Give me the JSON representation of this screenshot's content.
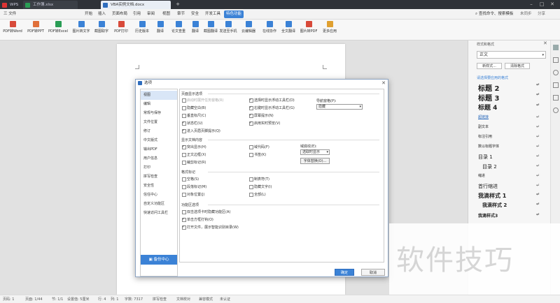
{
  "tabs": {
    "wps": "WPS",
    "xlsx": "工作簿.xlsx",
    "docx": "VBA实例文档.docx",
    "new_tab": "+"
  },
  "menu": {
    "file": "三 文件",
    "items": [
      "开始",
      "插入",
      "页面布局",
      "引用",
      "审阅",
      "视图",
      "章节",
      "安全",
      "开发工具",
      "特色功能"
    ],
    "search": "查找命令、搜索模板",
    "sync": "未同步",
    "share": "分享"
  },
  "ribbon": [
    "PDF转Word",
    "PDF转PPT",
    "PDF转Excel",
    "图片转文字",
    "截图取字",
    "PDF打印",
    "历史版本",
    "翻译",
    "论文查重",
    "翻译",
    "截图翻译",
    "发送至手机",
    "云编辑器",
    "在线协作",
    "全文翻译",
    "图片转PDF",
    "更多应用"
  ],
  "sidepanel": {
    "title": "样式和格式",
    "current_style": "正文",
    "new_style": "新样式...",
    "clear_format": "清除格式",
    "section_label": "请选择要应用的格式",
    "styles": [
      "标题 2",
      "标题 3",
      "标题 4",
      "超链接",
      "副文本",
      "标注引用",
      "数以标题字体",
      "目录 1",
      "目录 2",
      "缩进",
      "首行缩进",
      "我滴样式 1",
      "我滴样式 2",
      "我滴样式3"
    ]
  },
  "dialog": {
    "title": "选项",
    "nav": [
      "视图",
      "编辑",
      "常规与保存",
      "文件位置",
      "修订",
      "中文版式",
      "输出PDF",
      "用户信息",
      "打印",
      "拼写检查",
      "安全性",
      "信任中心",
      "自定义功能区",
      "快速访问工具栏"
    ],
    "backup": "备份中心",
    "sections": {
      "page_display": "页面显示选项",
      "show_content": "显示文档内容",
      "format_marks": "格式标记",
      "func_options": "功能区选项"
    },
    "checkboxes": {
      "page_display": [
        {
          "label": "启动时展开任务窗格(R)",
          "checked": false,
          "disabled": true
        },
        {
          "label": "隐藏空白(B)",
          "checked": false
        },
        {
          "label": "垂直标尺(C)",
          "checked": false
        },
        {
          "label": "状态栏(U)",
          "checked": true
        },
        {
          "label": "进入页眉页脚提示(Q)",
          "checked": true
        },
        {
          "label": "选择时显示浮动工具栏(D)",
          "checked": true
        },
        {
          "label": "右键时显示浮动工具栏(G)",
          "checked": true
        },
        {
          "label": "屏幕提示(N)",
          "checked": true
        },
        {
          "label": "启用实时预览(V)",
          "checked": true
        }
      ],
      "show_content": [
        {
          "label": "突出显示(H)",
          "checked": true
        },
        {
          "label": "正文边框(X)",
          "checked": false
        },
        {
          "label": "裁剪标记(R)",
          "checked": false
        },
        {
          "label": "域代码(F)",
          "checked": false
        },
        {
          "label": "书签(K)",
          "checked": false
        }
      ],
      "format_marks": [
        {
          "label": "空格(S)",
          "checked": false
        },
        {
          "label": "段落标记(M)",
          "checked": false
        },
        {
          "label": "对象位置(J)",
          "checked": false
        },
        {
          "label": "制表符(T)",
          "checked": false
        },
        {
          "label": "隐藏文字(I)",
          "checked": false
        },
        {
          "label": "全部(L)",
          "checked": false
        }
      ],
      "func_options": [
        {
          "label": "双击选项卡时隐藏功能区(A)",
          "checked": false
        },
        {
          "label": "单击方框打钩(O)",
          "checked": true
        },
        {
          "label": "打开文件，展示智能识别目录(W)",
          "checked": true
        }
      ]
    },
    "nav_pane_label": "导航窗格(P):",
    "nav_pane_value": "隐藏",
    "field_shading_label": "域底纹(E):",
    "field_shading_value": "选取时显示",
    "font_replace": "字体替换(O)...",
    "ok": "确定",
    "cancel": "取消"
  },
  "status": {
    "page": "页码: 1",
    "pages": "页面: 1/44",
    "section": "节: 1/1",
    "position": "设置值: 5厘米",
    "row": "行: 4",
    "col": "列: 1",
    "words": "字数: 7317",
    "spell": "拼写检查",
    "proof": "文档校对",
    "compat": "兼容模式",
    "auth": "未认证"
  },
  "watermark": "软件技巧"
}
